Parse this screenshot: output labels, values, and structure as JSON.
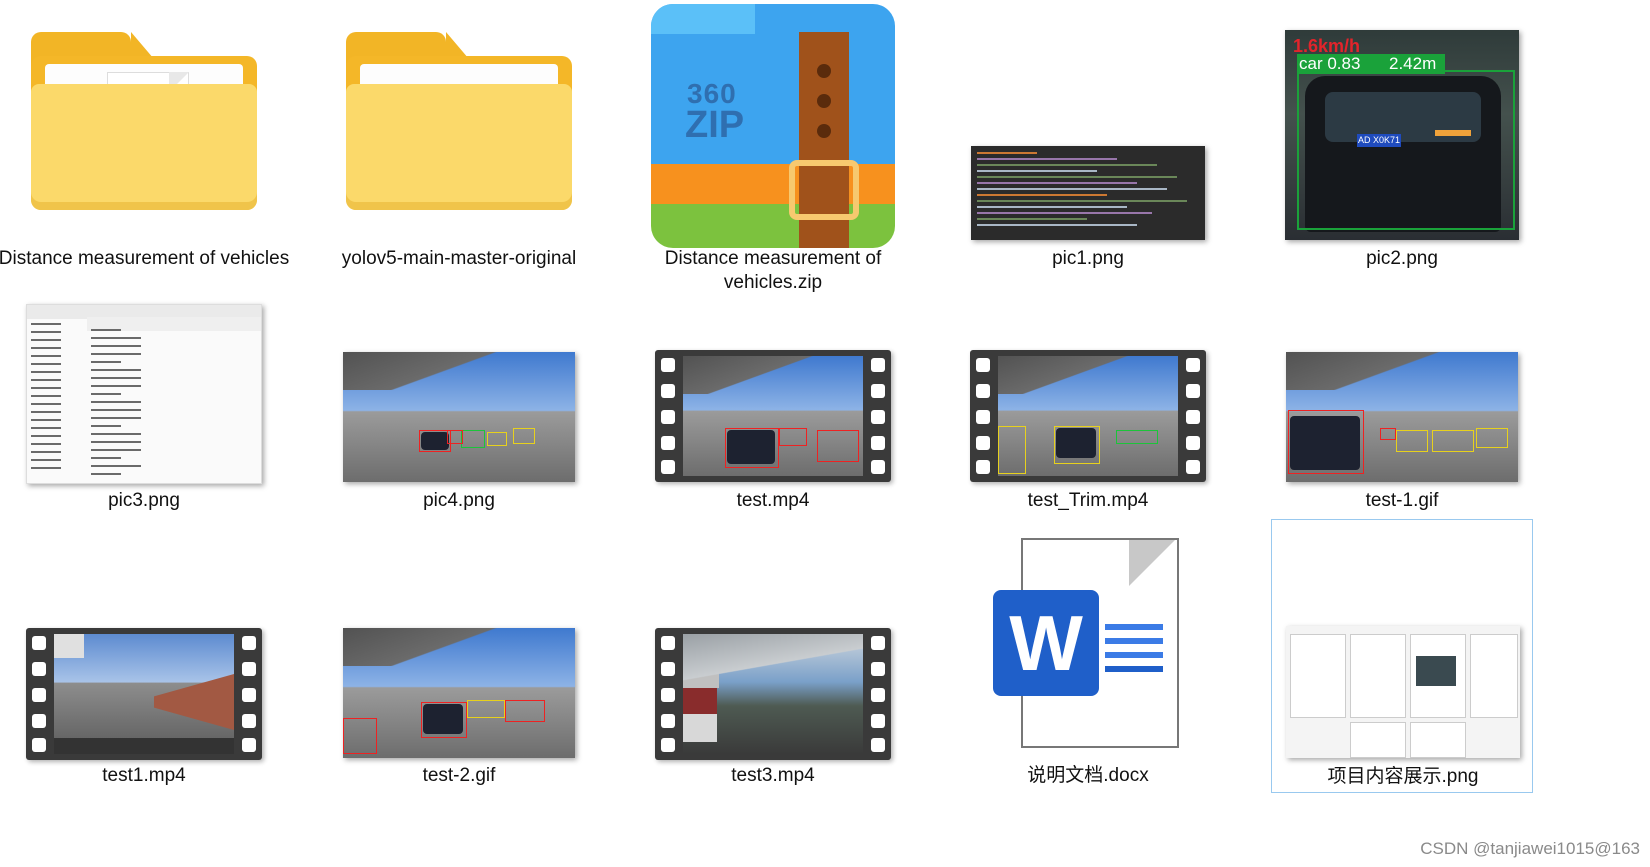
{
  "files": [
    {
      "name": "Distance measurement of vehicles",
      "type": "folder"
    },
    {
      "name": "yolov5-main-master-original",
      "type": "folder"
    },
    {
      "name": "Distance measurement of vehicles.zip",
      "type": "zip",
      "icon_text": [
        "360",
        "ZIP"
      ]
    },
    {
      "name": "pic1.png",
      "type": "image"
    },
    {
      "name": "pic2.png",
      "type": "image",
      "overlay": [
        "1.6km/h",
        "car 0.83",
        "2.42m"
      ],
      "plate": "AD X0K71"
    },
    {
      "name": "pic3.png",
      "type": "image"
    },
    {
      "name": "pic4.png",
      "type": "image"
    },
    {
      "name": "test.mp4",
      "type": "video"
    },
    {
      "name": "test_Trim.mp4",
      "type": "video"
    },
    {
      "name": "test-1.gif",
      "type": "image"
    },
    {
      "name": "test1.mp4",
      "type": "video"
    },
    {
      "name": "test-2.gif",
      "type": "image"
    },
    {
      "name": "test3.mp4",
      "type": "video"
    },
    {
      "name": "说明文档.docx",
      "type": "document",
      "icon_text": "W"
    },
    {
      "name": "项目内容展示.png",
      "type": "image",
      "selected": true
    }
  ],
  "watermark": "CSDN @tanjiawei1015@163"
}
